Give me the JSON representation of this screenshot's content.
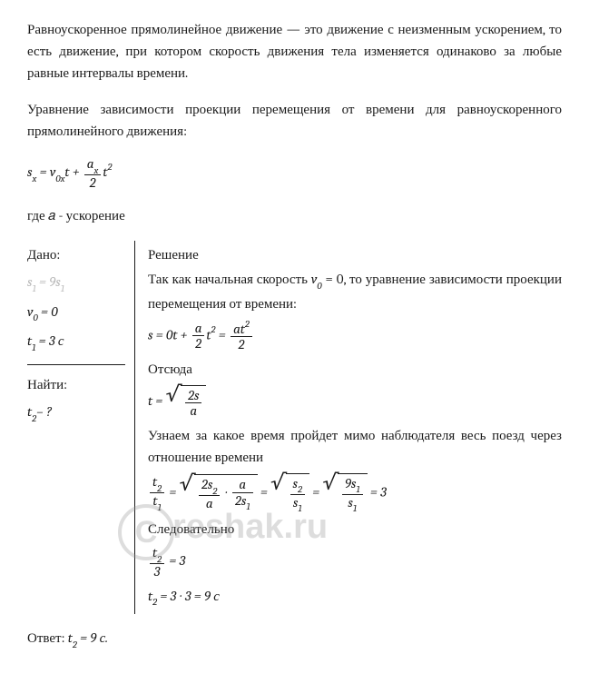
{
  "intro": {
    "p1": "Равноускоренное прямолинейное движение — это движение с неизменным ускорением, то есть движение, при котором скорость движения тела изменяется одинаково за любые равные интервалы времени.",
    "p2": "Уравнение зависимости проекции перемещения от времени для равноускоренного прямолинейного движения:",
    "where": "где 𝑎 - ускорение"
  },
  "formula_main": {
    "lhs": "s",
    "lhs_sub": "x",
    "eq": " = ",
    "v": "v",
    "v_sub": "0x",
    "t1": "t + ",
    "frac_num": "a",
    "frac_num_sub": "x",
    "frac_den": "2",
    "t2": "t",
    "t2_sup": "2"
  },
  "given": {
    "title": "Дано:",
    "line1_l": "s",
    "line1_lsub": "1",
    "line1_eq": " = 9",
    "line1_r": "s",
    "line1_rsub": "1",
    "line2_l": "v",
    "line2_lsub": "0",
    "line2_eq": " = 0",
    "line3_l": "t",
    "line3_lsub": "1",
    "line3_eq": " = 3 с"
  },
  "find": {
    "title": "Найти:",
    "line1_l": "t",
    "line1_lsub": "2",
    "line1_eq": "– ?"
  },
  "solution": {
    "title": "Решение",
    "p1_a": "Так как начальная скорость ",
    "p1_b": "v",
    "p1_b_sub": "0",
    "p1_c": " = 0, то уравнение зависимости проекции перемещения от времени:",
    "eq1_lhs": "s = 0t + ",
    "eq1_frac1_num": "a",
    "eq1_frac1_den": "2",
    "eq1_mid": "t",
    "eq1_mid_sup": "2",
    "eq1_eq": " = ",
    "eq1_frac2_num_a": "at",
    "eq1_frac2_num_sup": "2",
    "eq1_frac2_den": "2",
    "p2": "Отсюда",
    "eq2_lhs": "t = ",
    "eq2_sqrt_num": "2s",
    "eq2_sqrt_den": "a",
    "p3": "Узнаем за какое время пройдет мимо наблюдателя весь поезд через отношение времени",
    "eq3_frac1_num": "t",
    "eq3_frac1_num_sub": "2",
    "eq3_frac1_den": "t",
    "eq3_frac1_den_sub": "1",
    "eq3_eq1": " = ",
    "eq3_sqrt1_num_a": "2s",
    "eq3_sqrt1_num_sub": "2",
    "eq3_sqrt1_den": "a",
    "eq3_dot": " ∙ ",
    "eq3_sqrt1b_num": "a",
    "eq3_sqrt1b_den_a": "2s",
    "eq3_sqrt1b_den_sub": "1",
    "eq3_eq2": " = ",
    "eq3_sqrt2_num": "s",
    "eq3_sqrt2_num_sub": "2",
    "eq3_sqrt2_den": "s",
    "eq3_sqrt2_den_sub": "1",
    "eq3_eq3": " = ",
    "eq3_sqrt3_num_a": "9s",
    "eq3_sqrt3_num_sub": "1",
    "eq3_sqrt3_den": "s",
    "eq3_sqrt3_den_sub": "1",
    "eq3_eq4": " = 3",
    "p4": "Следовательно",
    "eq4_num": "t",
    "eq4_num_sub": "2",
    "eq4_den": "3",
    "eq4_eq": " = 3",
    "eq5_l": "t",
    "eq5_lsub": "2",
    "eq5_r": " = 3 ∙ 3 = 9 с"
  },
  "answer": {
    "label": "Ответ:  ",
    "t": "t",
    "t_sub": "2",
    "val": " = 9 с."
  },
  "watermark": {
    "c": "C",
    "text": "reshak.ru"
  }
}
